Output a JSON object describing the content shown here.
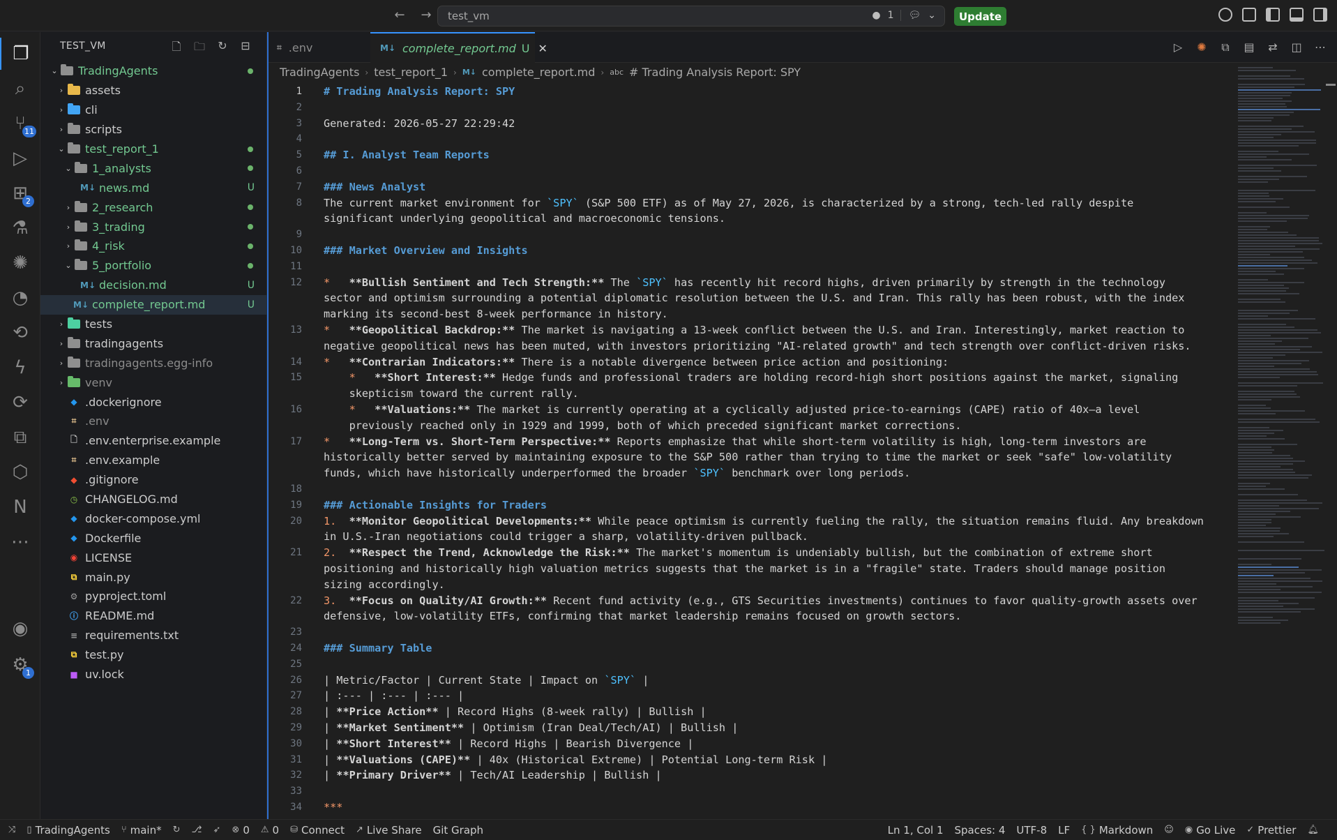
{
  "window": {
    "search_text": "test_vm",
    "problems_count": "1",
    "update_label": "Update"
  },
  "activity_bar": {
    "icons": [
      "explorer-icon",
      "search-icon",
      "source-control-icon",
      "run-debug-icon",
      "extensions-icon",
      "testing-icon",
      "claude-icon",
      "timeline-icon",
      "git-graph-icon",
      "thunder-client-icon",
      "remote-explorer-icon",
      "python-icon",
      "docker-icon",
      "n8n-icon",
      "more-icon",
      "account-icon",
      "settings-icon"
    ],
    "badges": {
      "source_control": "11",
      "extensions": "2",
      "settings": "1"
    }
  },
  "explorer": {
    "title": "TEST_VM",
    "tree": [
      {
        "label": "TradingAgents",
        "depth": 0,
        "type": "folder-open",
        "status": "dot",
        "color": "green"
      },
      {
        "label": "assets",
        "depth": 1,
        "type": "folder",
        "icon_color": "#e8b84a"
      },
      {
        "label": "cli",
        "depth": 1,
        "type": "folder",
        "icon_color": "#42a5f5"
      },
      {
        "label": "scripts",
        "depth": 1,
        "type": "folder",
        "icon_color": "#8f8f8f"
      },
      {
        "label": "test_report_1",
        "depth": 1,
        "type": "folder-open",
        "status": "dot",
        "color": "green"
      },
      {
        "label": "1_analysts",
        "depth": 2,
        "type": "folder-open",
        "status": "dot",
        "color": "green"
      },
      {
        "label": "news.md",
        "depth": 3,
        "type": "md",
        "status": "U",
        "color": "green"
      },
      {
        "label": "2_research",
        "depth": 2,
        "type": "folder",
        "status": "dot",
        "color": "green"
      },
      {
        "label": "3_trading",
        "depth": 2,
        "type": "folder",
        "status": "dot",
        "color": "green"
      },
      {
        "label": "4_risk",
        "depth": 2,
        "type": "folder",
        "status": "dot",
        "color": "green"
      },
      {
        "label": "5_portfolio",
        "depth": 2,
        "type": "folder-open",
        "status": "dot",
        "color": "green"
      },
      {
        "label": "decision.md",
        "depth": 3,
        "type": "md",
        "status": "U",
        "color": "green"
      },
      {
        "label": "complete_report.md",
        "depth": 2,
        "type": "md",
        "status": "U",
        "color": "green",
        "selected": true
      },
      {
        "label": "tests",
        "depth": 1,
        "type": "folder",
        "icon_color": "#4dd0a1"
      },
      {
        "label": "tradingagents",
        "depth": 1,
        "type": "folder",
        "icon_color": "#8f8f8f"
      },
      {
        "label": "tradingagents.egg-info",
        "depth": 1,
        "type": "folder",
        "icon_color": "#8f8f8f",
        "color": "muted"
      },
      {
        "label": "venv",
        "depth": 1,
        "type": "folder",
        "icon_color": "#66bb6a",
        "color": "muted"
      },
      {
        "label": ".dockerignore",
        "depth": 1,
        "type": "docker"
      },
      {
        "label": ".env",
        "depth": 1,
        "type": "env",
        "color": "muted"
      },
      {
        "label": ".env.enterprise.example",
        "depth": 1,
        "type": "file"
      },
      {
        "label": ".env.example",
        "depth": 1,
        "type": "env"
      },
      {
        "label": ".gitignore",
        "depth": 1,
        "type": "git"
      },
      {
        "label": "CHANGELOG.md",
        "depth": 1,
        "type": "changelog"
      },
      {
        "label": "docker-compose.yml",
        "depth": 1,
        "type": "docker"
      },
      {
        "label": "Dockerfile",
        "depth": 1,
        "type": "docker"
      },
      {
        "label": "LICENSE",
        "depth": 1,
        "type": "license"
      },
      {
        "label": "main.py",
        "depth": 1,
        "type": "python"
      },
      {
        "label": "pyproject.toml",
        "depth": 1,
        "type": "toml"
      },
      {
        "label": "README.md",
        "depth": 1,
        "type": "info"
      },
      {
        "label": "requirements.txt",
        "depth": 1,
        "type": "txt"
      },
      {
        "label": "test.py",
        "depth": 1,
        "type": "python"
      },
      {
        "label": "uv.lock",
        "depth": 1,
        "type": "lock"
      }
    ]
  },
  "tabs": [
    {
      "label": ".env",
      "icon": "env-icon",
      "active": false
    },
    {
      "label": "complete_report.md",
      "status": "U",
      "icon": "markdown-icon",
      "active": true
    }
  ],
  "breadcrumb": [
    "TradingAgents",
    "test_report_1",
    "complete_report.md",
    "# Trading Analysis Report: SPY"
  ],
  "editor": {
    "current_line": "1",
    "lines": [
      {
        "n": "1",
        "segs": [
          [
            "h",
            "# Trading Analysis Report: SPY"
          ]
        ]
      },
      {
        "n": "2",
        "segs": []
      },
      {
        "n": "3",
        "segs": [
          [
            "t",
            "Generated: 2026-05-27 22:29:42"
          ]
        ]
      },
      {
        "n": "4",
        "segs": []
      },
      {
        "n": "5",
        "segs": [
          [
            "h",
            "## I. Analyst Team Reports"
          ]
        ]
      },
      {
        "n": "6",
        "segs": []
      },
      {
        "n": "7",
        "segs": [
          [
            "h",
            "### News Analyst"
          ]
        ]
      },
      {
        "n": "8",
        "segs": [
          [
            "t",
            "The current market environment for "
          ],
          [
            "c",
            "`SPY`"
          ],
          [
            "t",
            " (S&P 500 ETF) as of May 27, 2026, is characterized by a strong, tech-led rally despite"
          ]
        ]
      },
      {
        "n": "",
        "segs": [
          [
            "t",
            "significant underlying geopolitical and macroeconomic tensions."
          ]
        ]
      },
      {
        "n": "9",
        "segs": []
      },
      {
        "n": "10",
        "segs": [
          [
            "h",
            "### Market Overview and Insights"
          ]
        ]
      },
      {
        "n": "11",
        "segs": []
      },
      {
        "n": "12",
        "segs": [
          [
            "m",
            "*"
          ],
          [
            "t",
            "   "
          ],
          [
            "b",
            "**Bullish Sentiment and Tech Strength:**"
          ],
          [
            "t",
            " The "
          ],
          [
            "c",
            "`SPY`"
          ],
          [
            "t",
            " has recently hit record highs, driven primarily by strength in the technology"
          ]
        ]
      },
      {
        "n": "",
        "segs": [
          [
            "t",
            "sector and optimism surrounding a potential diplomatic resolution between the U.S. and Iran. This rally has been robust, with the index"
          ]
        ]
      },
      {
        "n": "",
        "segs": [
          [
            "t",
            "marking its second-best 8-week performance in history."
          ]
        ]
      },
      {
        "n": "13",
        "segs": [
          [
            "m",
            "*"
          ],
          [
            "t",
            "   "
          ],
          [
            "b",
            "**Geopolitical Backdrop:**"
          ],
          [
            "t",
            " The market is navigating a 13-week conflict between the U.S. and Iran. Interestingly, market reaction to"
          ]
        ]
      },
      {
        "n": "",
        "segs": [
          [
            "t",
            "negative geopolitical news has been muted, with investors prioritizing \"AI-related growth\" and tech strength over conflict-driven risks."
          ]
        ]
      },
      {
        "n": "14",
        "segs": [
          [
            "m",
            "*"
          ],
          [
            "t",
            "   "
          ],
          [
            "b",
            "**Contrarian Indicators:**"
          ],
          [
            "t",
            " There is a notable divergence between price action and positioning:"
          ]
        ]
      },
      {
        "n": "15",
        "segs": [
          [
            "t",
            "    "
          ],
          [
            "m",
            "*"
          ],
          [
            "t",
            "   "
          ],
          [
            "b",
            "**Short Interest:**"
          ],
          [
            "t",
            " Hedge funds and professional traders are holding record-high short positions against the market, signaling"
          ]
        ]
      },
      {
        "n": "",
        "segs": [
          [
            "t",
            "    skepticism toward the current rally."
          ]
        ]
      },
      {
        "n": "16",
        "segs": [
          [
            "t",
            "    "
          ],
          [
            "m",
            "*"
          ],
          [
            "t",
            "   "
          ],
          [
            "b",
            "**Valuations:**"
          ],
          [
            "t",
            " The market is currently operating at a cyclically adjusted price-to-earnings (CAPE) ratio of 40x—a level"
          ]
        ]
      },
      {
        "n": "",
        "segs": [
          [
            "t",
            "    previously reached only in 1929 and 1999, both of which preceded significant market corrections."
          ]
        ]
      },
      {
        "n": "17",
        "segs": [
          [
            "m",
            "*"
          ],
          [
            "t",
            "   "
          ],
          [
            "b",
            "**Long-Term vs. Short-Term Perspective:**"
          ],
          [
            "t",
            " Reports emphasize that while short-term volatility is high, long-term investors are"
          ]
        ]
      },
      {
        "n": "",
        "segs": [
          [
            "t",
            "historically better served by maintaining exposure to the S&P 500 rather than trying to time the market or seek \"safe\" low-volatility"
          ]
        ]
      },
      {
        "n": "",
        "segs": [
          [
            "t",
            "funds, which have historically underperformed the broader "
          ],
          [
            "c",
            "`SPY`"
          ],
          [
            "t",
            " benchmark over long periods."
          ]
        ]
      },
      {
        "n": "18",
        "segs": []
      },
      {
        "n": "19",
        "segs": [
          [
            "h",
            "### Actionable Insights for Traders"
          ]
        ]
      },
      {
        "n": "20",
        "segs": [
          [
            "m",
            "1."
          ],
          [
            "t",
            "  "
          ],
          [
            "b",
            "**Monitor Geopolitical Developments:**"
          ],
          [
            "t",
            " While peace optimism is currently fueling the rally, the situation remains fluid. Any breakdown"
          ]
        ]
      },
      {
        "n": "",
        "segs": [
          [
            "t",
            "in U.S.-Iran negotiations could trigger a sharp, volatility-driven pullback."
          ]
        ]
      },
      {
        "n": "21",
        "segs": [
          [
            "m",
            "2."
          ],
          [
            "t",
            "  "
          ],
          [
            "b",
            "**Respect the Trend, Acknowledge the Risk:**"
          ],
          [
            "t",
            " The market's momentum is undeniably bullish, but the combination of extreme short"
          ]
        ]
      },
      {
        "n": "",
        "segs": [
          [
            "t",
            "positioning and historically high valuation metrics suggests that the market is in a \"fragile\" state. Traders should manage position"
          ]
        ]
      },
      {
        "n": "",
        "segs": [
          [
            "t",
            "sizing accordingly."
          ]
        ]
      },
      {
        "n": "22",
        "segs": [
          [
            "m",
            "3."
          ],
          [
            "t",
            "  "
          ],
          [
            "b",
            "**Focus on Quality/AI Growth:**"
          ],
          [
            "t",
            " Recent fund activity (e.g., GTS Securities investments) continues to favor quality-growth assets over"
          ]
        ]
      },
      {
        "n": "",
        "segs": [
          [
            "t",
            "defensive, low-volatility ETFs, confirming that market leadership remains focused on growth sectors."
          ]
        ]
      },
      {
        "n": "23",
        "segs": []
      },
      {
        "n": "24",
        "segs": [
          [
            "h",
            "### Summary Table"
          ]
        ]
      },
      {
        "n": "25",
        "segs": []
      },
      {
        "n": "26",
        "segs": [
          [
            "t",
            "| Metric/Factor | Current State | Impact on "
          ],
          [
            "c",
            "`SPY`"
          ],
          [
            "t",
            " |"
          ]
        ]
      },
      {
        "n": "27",
        "segs": [
          [
            "t",
            "| :--- | :--- | :--- |"
          ]
        ]
      },
      {
        "n": "28",
        "segs": [
          [
            "t",
            "| "
          ],
          [
            "b",
            "**Price Action**"
          ],
          [
            "t",
            " | Record Highs (8-week rally) | Bullish |"
          ]
        ]
      },
      {
        "n": "29",
        "segs": [
          [
            "t",
            "| "
          ],
          [
            "b",
            "**Market Sentiment**"
          ],
          [
            "t",
            " | Optimism (Iran Deal/Tech/AI) | Bullish |"
          ]
        ]
      },
      {
        "n": "30",
        "segs": [
          [
            "t",
            "| "
          ],
          [
            "b",
            "**Short Interest**"
          ],
          [
            "t",
            " | Record Highs | Bearish Divergence |"
          ]
        ]
      },
      {
        "n": "31",
        "segs": [
          [
            "t",
            "| "
          ],
          [
            "b",
            "**Valuations (CAPE)**"
          ],
          [
            "t",
            " | 40x (Historical Extreme) | Potential Long-term Risk |"
          ]
        ]
      },
      {
        "n": "32",
        "segs": [
          [
            "t",
            "| "
          ],
          [
            "b",
            "**Primary Driver**"
          ],
          [
            "t",
            " | Tech/AI Leadership | Bullish |"
          ]
        ]
      },
      {
        "n": "33",
        "segs": []
      },
      {
        "n": "34",
        "segs": [
          [
            "m",
            "***"
          ]
        ]
      }
    ]
  },
  "status_bar": {
    "left": [
      {
        "icon": "remote-icon",
        "label": ""
      },
      {
        "icon": "repo-icon",
        "label": "TradingAgents"
      },
      {
        "icon": "branch-icon",
        "label": "main*"
      },
      {
        "icon": "sync-icon",
        "label": ""
      },
      {
        "icon": "graph-icon",
        "label": ""
      },
      {
        "icon": "rocket-icon",
        "label": ""
      },
      {
        "icon": "error-icon",
        "label": "0"
      },
      {
        "icon": "warning-icon",
        "label": "0"
      },
      {
        "icon": "database-icon",
        "label": "Connect"
      },
      {
        "icon": "live-share-icon",
        "label": "Live Share"
      },
      {
        "icon": "",
        "label": "Git Graph"
      }
    ],
    "right": [
      {
        "icon": "",
        "label": "Ln 1, Col 1"
      },
      {
        "icon": "",
        "label": "Spaces: 4"
      },
      {
        "icon": "",
        "label": "UTF-8"
      },
      {
        "icon": "",
        "label": "LF"
      },
      {
        "icon": "braces-icon",
        "label": "Markdown"
      },
      {
        "icon": "copilot-icon",
        "label": ""
      },
      {
        "icon": "broadcast-icon",
        "label": "Go Live"
      },
      {
        "icon": "check-icon",
        "label": "Prettier"
      },
      {
        "icon": "bell-icon",
        "label": ""
      }
    ]
  }
}
